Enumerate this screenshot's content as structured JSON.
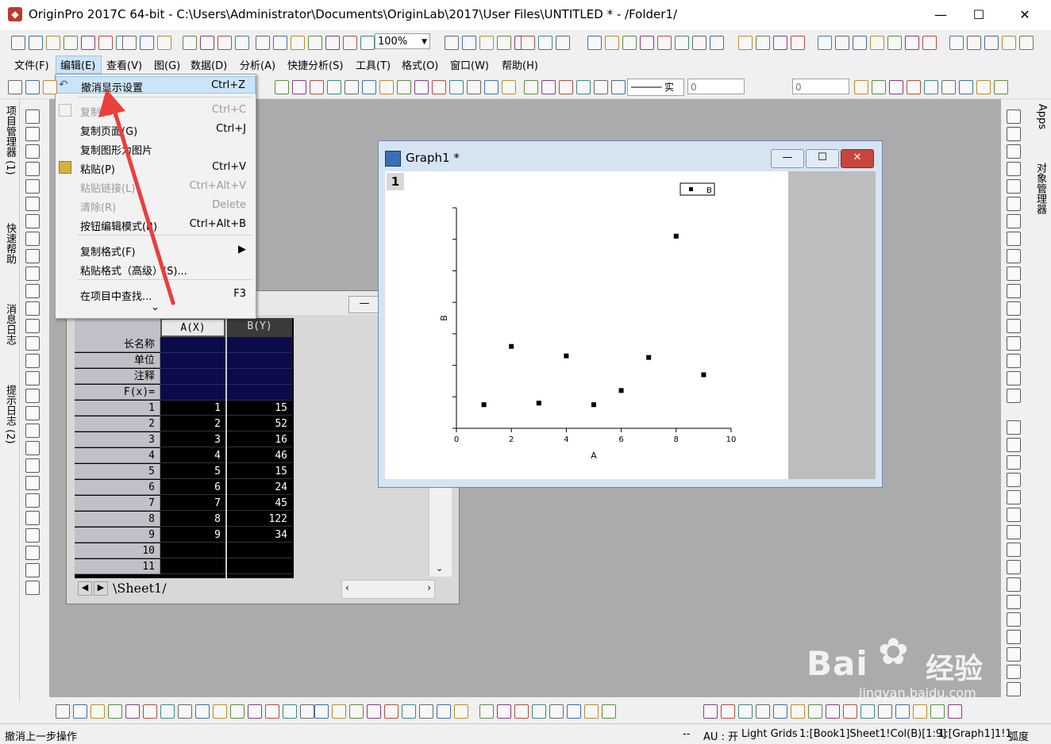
{
  "window": {
    "title": "OriginPro 2017C 64-bit - C:\\Users\\Administrator\\Documents\\OriginLab\\2017\\User Files\\UNTITLED * - /Folder1/",
    "minimize": "—",
    "maximize": "☐",
    "close": "✕"
  },
  "toolbar": {
    "zoom": "100%"
  },
  "format_toolbar": {
    "line_label": "实",
    "size1": "0",
    "size2": "0"
  },
  "menu": [
    "文件(F)",
    "编辑(E)",
    "查看(V)",
    "图(G)",
    "数据(D)",
    "分析(A)",
    "快捷分析(S)",
    "工具(T)",
    "格式(O)",
    "窗口(W)",
    "帮助(H)"
  ],
  "edit_menu": [
    {
      "label": "撤消显示设置",
      "shortcut": "Ctrl+Z",
      "state": "highlight"
    },
    {
      "label": "复制(C)",
      "shortcut": "Ctrl+C",
      "state": "disabled"
    },
    {
      "label": "复制页面(G)",
      "shortcut": "Ctrl+J",
      "state": "normal"
    },
    {
      "label": "复制图形为图片",
      "shortcut": "",
      "state": "normal"
    },
    {
      "label": "粘贴(P)",
      "shortcut": "Ctrl+V",
      "state": "normal"
    },
    {
      "label": "粘贴链接(L)",
      "shortcut": "Ctrl+Alt+V",
      "state": "disabled"
    },
    {
      "label": "清除(R)",
      "shortcut": "Delete",
      "state": "disabled"
    },
    {
      "label": "按钮编辑模式(B)",
      "shortcut": "Ctrl+Alt+B",
      "state": "normal"
    },
    {
      "label": "复制格式(F)",
      "shortcut": "▶",
      "state": "normal"
    },
    {
      "label": "粘贴格式（高级）(S)...",
      "shortcut": "",
      "state": "normal"
    },
    {
      "label": "在项目中查找...",
      "shortcut": "F3",
      "state": "normal"
    },
    {
      "label": "⌄",
      "shortcut": "",
      "state": "more"
    }
  ],
  "left_panel_tabs": [
    "项目管理器 (1)",
    "快速帮助",
    "消息日志",
    "提示日志 (2)"
  ],
  "right_panel_tabs": [
    "Apps",
    "对象管理器"
  ],
  "workbook": {
    "columns": [
      "A(X)",
      "B(Y)"
    ],
    "meta_rows": [
      "长名称",
      "单位",
      "注释",
      "F(x)="
    ],
    "rows": [
      {
        "n": "1",
        "a": "1",
        "b": "15"
      },
      {
        "n": "2",
        "a": "2",
        "b": "52"
      },
      {
        "n": "3",
        "a": "3",
        "b": "16"
      },
      {
        "n": "4",
        "a": "4",
        "b": "46"
      },
      {
        "n": "5",
        "a": "5",
        "b": "15"
      },
      {
        "n": "6",
        "a": "6",
        "b": "24"
      },
      {
        "n": "7",
        "a": "7",
        "b": "45"
      },
      {
        "n": "8",
        "a": "8",
        "b": "122"
      },
      {
        "n": "9",
        "a": "9",
        "b": "34"
      },
      {
        "n": "10",
        "a": "",
        "b": ""
      },
      {
        "n": "11",
        "a": "",
        "b": ""
      }
    ],
    "sheet_tab": "Sheet1"
  },
  "graph": {
    "title": "Graph1 *",
    "layer": "1",
    "legend": "B"
  },
  "chart_data": {
    "type": "scatter",
    "x": [
      1,
      2,
      3,
      4,
      5,
      6,
      7,
      8,
      9
    ],
    "y": [
      15,
      52,
      16,
      46,
      15,
      24,
      45,
      122,
      34
    ],
    "xlabel": "A",
    "ylabel": "B",
    "xlim": [
      0,
      10
    ],
    "ylim": [
      0,
      140
    ],
    "xticks": [
      0,
      2,
      4,
      6,
      8,
      10
    ],
    "legend": "B",
    "color": "#000000"
  },
  "status": {
    "left": "撤消上一步操作",
    "dash": "--",
    "au": "AU : 开",
    "grids": "Light Grids",
    "col": "1:[Book1]Sheet1!Col(B)[1:9]",
    "graph": "1:[Graph1]1!1",
    "unit": "弧度"
  },
  "watermark": {
    "brand": "Bai",
    "cn": "经验",
    "url": "jingyan.baidu.com"
  },
  "colors": {
    "menu_highlight": "#cce4f7",
    "workspace": "#ababab",
    "data_bg": "#000000",
    "meta_bg": "#0b0b4a",
    "arrow": "#e8403a"
  }
}
